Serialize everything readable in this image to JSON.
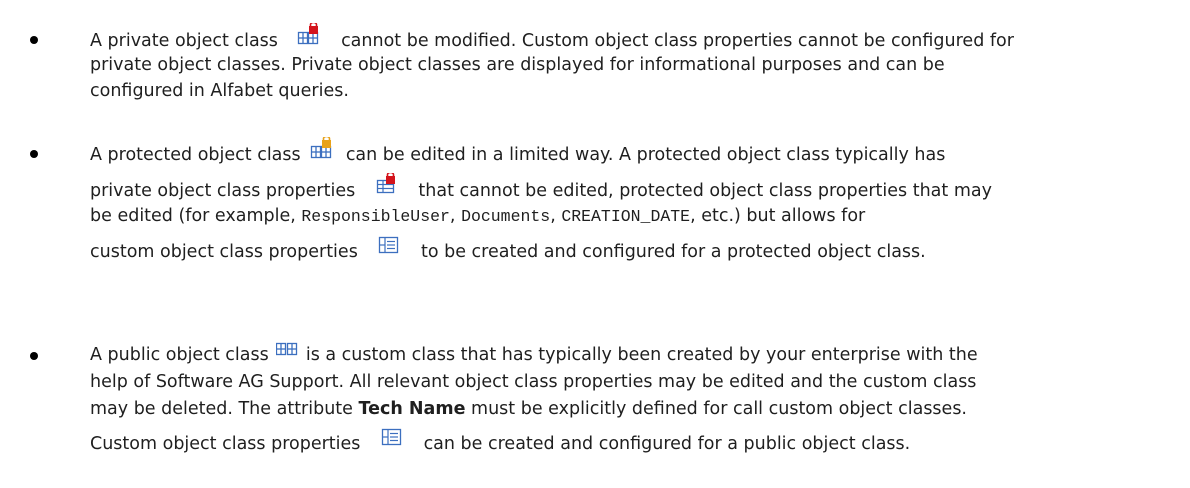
{
  "items": [
    {
      "lines": [
        [
          "A private object class",
          "cannot be modified. Custom object class properties cannot be configured for"
        ],
        [
          "private object classes. Private object classes are displayed for informational purposes and can be"
        ],
        [
          "configured in Alfabet queries."
        ]
      ]
    },
    {
      "lines": [
        [
          "A protected object class",
          "can be edited in a limited way. A protected object class typically has"
        ],
        [
          "private object class properties",
          "that cannot be edited, protected object class properties that may"
        ],
        [
          "be edited (for example, ",
          "ResponsibleUser",
          ", ",
          "Documents",
          ", ",
          "CREATION_DATE",
          ", etc.) but allows for"
        ],
        [
          "custom object class properties",
          "to be created and configured for a protected object class."
        ]
      ]
    },
    {
      "lines": [
        [
          "A public object class",
          "is a custom class that has typically been created by your enterprise with the"
        ],
        [
          "help of Software AG Support. All relevant object class properties may be edited and the custom class"
        ],
        [
          "may be deleted. The attribute ",
          "Tech Name",
          " must be explicitly defined for call custom object classes."
        ],
        [
          "Custom object class properties",
          "can be created and configured for a public object class."
        ]
      ]
    }
  ],
  "icons": {
    "private_class": "private-class-icon",
    "protected_class": "protected-class-icon",
    "private_property": "private-property-icon",
    "custom_property": "custom-property-icon",
    "public_class": "public-class-icon"
  },
  "colors": {
    "icon_blue": "#3c6fbf",
    "lock_red": "#d4141c",
    "lock_orange": "#e8a21a",
    "text": "#1f1f1f"
  }
}
